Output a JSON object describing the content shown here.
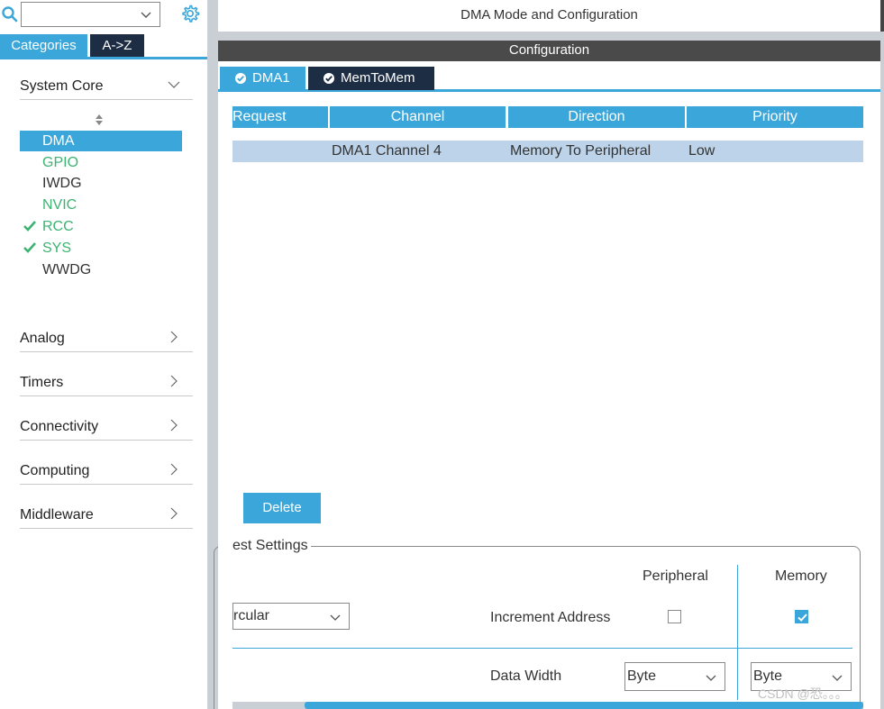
{
  "left": {
    "search": {
      "value": "",
      "placeholder": ""
    },
    "tabs": {
      "categories": "Categories",
      "atoz": "A->Z"
    },
    "system_core": {
      "label": "System Core",
      "items": [
        {
          "label": "DMA",
          "state": "selected"
        },
        {
          "label": "GPIO",
          "state": "green"
        },
        {
          "label": "IWDG",
          "state": "normal"
        },
        {
          "label": "NVIC",
          "state": "green"
        },
        {
          "label": "RCC",
          "state": "checked"
        },
        {
          "label": "SYS",
          "state": "checked"
        },
        {
          "label": "WWDG",
          "state": "normal"
        }
      ]
    },
    "sections": [
      "Analog",
      "Timers",
      "Connectivity",
      "Computing",
      "Middleware"
    ]
  },
  "right": {
    "mode_title": "DMA Mode and Configuration",
    "config_title": "Configuration",
    "tabs": {
      "dma1": "DMA1",
      "memtomem": "MemToMem"
    },
    "table": {
      "headers": [
        "Request",
        "Channel",
        "Direction",
        "Priority"
      ],
      "rows": [
        [
          "",
          "DMA1 Channel 4",
          "Memory To Peripheral",
          "Low"
        ]
      ]
    },
    "delete_label": "Delete",
    "settings": {
      "legend": "est Settings",
      "col_peripheral": "Peripheral",
      "col_memory": "Memory",
      "mode_value": "rcular",
      "increment_label": "Increment Address",
      "increment_peripheral": false,
      "increment_memory": true,
      "data_width_label": "Data Width",
      "data_width_peripheral": "Byte",
      "data_width_memory": "Byte"
    }
  },
  "watermark": "CSDN @恐。。。",
  "colors": {
    "accent": "#3ba6d9",
    "dark_tab": "#1d2d44",
    "green": "#3cb371",
    "row_bg": "#bcd3e9"
  }
}
